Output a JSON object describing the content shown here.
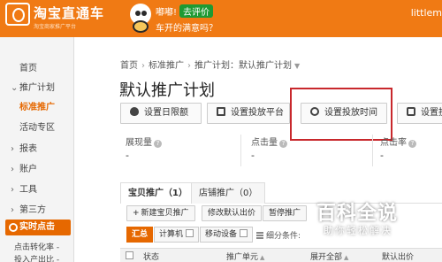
{
  "header": {
    "logo_title": "淘宝直通车",
    "logo_subtitle": "淘宝商家推广平台",
    "promo_greeting": "嘟嘟!",
    "promo_button": "去评价",
    "promo_question": "车开的满意吗？",
    "user_name": "littlem"
  },
  "sidebar": {
    "items": [
      {
        "label": "首页"
      },
      {
        "label": "推广计划"
      },
      {
        "label": "标准推广"
      },
      {
        "label": "活动专区"
      },
      {
        "label": "报表"
      },
      {
        "label": "账户"
      },
      {
        "label": "工具"
      },
      {
        "label": "第三方"
      }
    ],
    "hot_section": "实时点击",
    "hot_items": [
      "点击转化率 -",
      "投入产出比 -"
    ]
  },
  "breadcrumb": {
    "home": "首页",
    "level2": "标准推广",
    "level3": "推广计划：默认推广计划"
  },
  "page_title": "默认推广计划",
  "buttons": {
    "daily_limit": "设置日限额",
    "platform": "设置投放平台",
    "time": "设置投放时间",
    "region": "设置投"
  },
  "stats": {
    "impressions_label": "展现量",
    "impressions_value": "-",
    "clicks_label": "点击量",
    "clicks_value": "-",
    "ctr_label": "点击率",
    "ctr_value": "-",
    "help_mark": "?"
  },
  "tabs": {
    "product": "宝贝推广（1）",
    "store": "店铺推广（0）"
  },
  "actions": {
    "new_product": "新建宝贝推广",
    "edit_bid": "修改默认出价",
    "pause": "暂停推广"
  },
  "filters": {
    "all": "汇总",
    "computer": "计算机",
    "mobile": "移动设备",
    "segment": "细分条件:"
  },
  "table": {
    "status": "状态",
    "unit": "推广单元",
    "keyword": "展开全部",
    "default_bid": "默认出价",
    "sort": "▲"
  },
  "watermark": {
    "title": "百科全说",
    "subtitle": "助你轻松解决"
  },
  "colors": {
    "brand_orange": "#f07a14",
    "active_orange": "#e66800",
    "highlight_red": "#c8282c",
    "promo_green": "#1e9a33"
  }
}
